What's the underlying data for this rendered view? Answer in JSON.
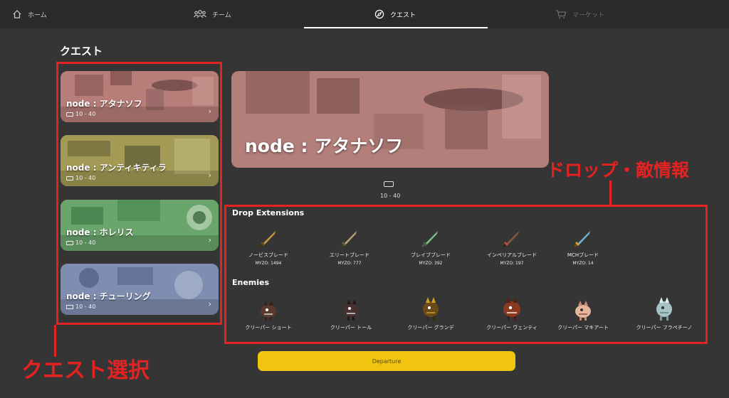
{
  "nav": {
    "tabs": [
      {
        "label": "ホーム",
        "icon": "home-icon"
      },
      {
        "label": "チーム",
        "icon": "team-icon"
      },
      {
        "label": "クエスト",
        "icon": "compass-icon",
        "active": true
      },
      {
        "label": "マーケット",
        "icon": "cart-icon",
        "disabled": true
      }
    ]
  },
  "page_title": "クエスト",
  "quests": [
    {
      "name": "node : アタナソフ",
      "range": "10 - 40",
      "color": "#b77d78"
    },
    {
      "name": "node : アンティキティラ",
      "range": "10 - 40",
      "color": "#a39a55"
    },
    {
      "name": "node : ホレリス",
      "range": "10 - 40",
      "color": "#6aa56b"
    },
    {
      "name": "node : チューリング",
      "range": "10 - 40",
      "color": "#7e8db0"
    }
  ],
  "selected": {
    "name": "node : アタナソフ",
    "range": "10 - 40"
  },
  "drops": {
    "title": "Drop Extensions",
    "items": [
      {
        "name": "ノービスブレード",
        "count": "MYZO: 1494",
        "icon": "bronze-sword-icon",
        "color": "#c99a3a"
      },
      {
        "name": "エリートブレード",
        "count": "MYZO: 777",
        "icon": "silver-sword-icon",
        "color": "#b7a27a"
      },
      {
        "name": "ブレイブブレード",
        "count": "MYZO: 392",
        "icon": "green-sword-icon",
        "color": "#7fbf87"
      },
      {
        "name": "インペリアルブレード",
        "count": "MYZO: 197",
        "icon": "dark-sword-icon",
        "color": "#8a5a3a"
      },
      {
        "name": "MCHブレード",
        "count": "MYZO: 14",
        "icon": "blue-sword-icon",
        "color": "#6fb3d9"
      }
    ]
  },
  "enemies": {
    "title": "Enemies",
    "items": [
      {
        "name": "クリーパー ショート",
        "icon": "creeper-short-icon",
        "color": "#5a3a2a"
      },
      {
        "name": "クリーパー トール",
        "icon": "creeper-tall-icon",
        "color": "#4a3030"
      },
      {
        "name": "クリーパー グランデ",
        "icon": "creeper-grande-icon",
        "color": "#8a6a20"
      },
      {
        "name": "クリーパー ヴェンティ",
        "icon": "creeper-venti-icon",
        "color": "#8a3a20"
      },
      {
        "name": "クリーパー マキアート",
        "icon": "creeper-macchiato-icon",
        "color": "#e6b59a"
      },
      {
        "name": "クリーパー フラペチーノ",
        "icon": "creeper-frappuccino-icon",
        "color": "#a8c3c8"
      }
    ]
  },
  "departure_label": "Departure",
  "annotations": {
    "quest_select": "クエスト選択",
    "drop_enemy_info": "ドロップ・敵情報"
  }
}
